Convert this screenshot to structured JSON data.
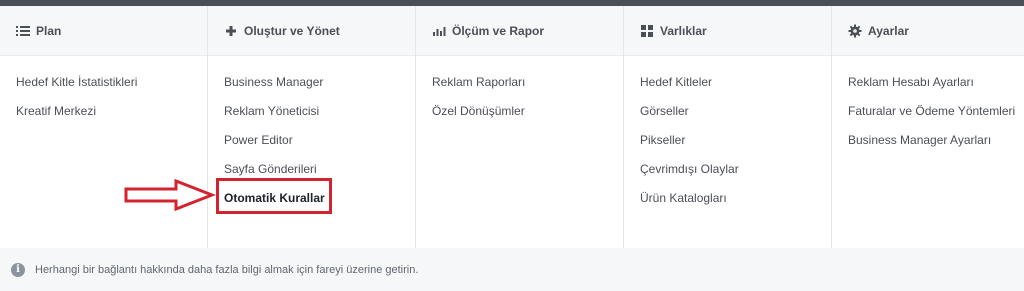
{
  "columns": [
    {
      "header": "Plan",
      "icon": "list-icon",
      "items": [
        "Hedef Kitle İstatistikleri",
        "Kreatif Merkezi"
      ]
    },
    {
      "header": "Oluştur ve Yönet",
      "icon": "plus-icon",
      "items": [
        "Business Manager",
        "Reklam Yöneticisi",
        "Power Editor",
        "Sayfa Gönderileri",
        "Otomatik Kurallar"
      ]
    },
    {
      "header": "Ölçüm ve Rapor",
      "icon": "bar-chart-icon",
      "items": [
        "Reklam Raporları",
        "Özel Dönüşümler"
      ]
    },
    {
      "header": "Varlıklar",
      "icon": "grid-icon",
      "items": [
        "Hedef Kitleler",
        "Görseller",
        "Pikseller",
        "Çevrimdışı Olaylar",
        "Ürün Katalogları"
      ]
    },
    {
      "header": "Ayarlar",
      "icon": "gear-icon",
      "items": [
        "Reklam Hesabı Ayarları",
        "Faturalar ve Ödeme Yöntemleri",
        "Business Manager Ayarları"
      ]
    }
  ],
  "footer": {
    "icon": "info-icon",
    "text": "Herhangi bir bağlantı hakkında daha fazla bilgi almak için fareyi üzerine getirin."
  },
  "annotation": {
    "highlight_color": "#d3232f",
    "arrow_icon": "right-arrow-icon"
  }
}
